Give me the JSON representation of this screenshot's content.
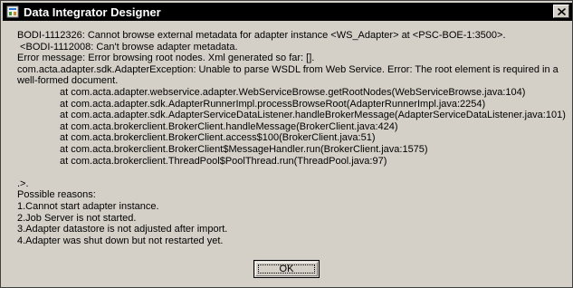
{
  "window": {
    "title": "Data Integrator Designer"
  },
  "message": {
    "line1": "BODI-1112326: Cannot browse external metadata for adapter instance <WS_Adapter> at <PSC-BOE-1:3500>.",
    "line2": " <BODI-1112008: Can't browse adapter metadata.",
    "line3": "Error message: Error browsing root nodes. Xml generated so far: [].",
    "line4": "com.acta.adapter.sdk.AdapterException: Unable to parse WSDL from Web Service. Error: The root element is required in a well-formed document.",
    "stack": [
      "at com.acta.adapter.webservice.adapter.WebServiceBrowse.getRootNodes(WebServiceBrowse.java:104)",
      "at com.acta.adapter.sdk.AdapterRunnerImpl.processBrowseRoot(AdapterRunnerImpl.java:2254)",
      "at com.acta.adapter.sdk.AdapterServiceDataListener.handleBrokerMessage(AdapterServiceDataListener.java:101)",
      "at com.acta.brokerclient.BrokerClient.handleMessage(BrokerClient.java:424)",
      "at com.acta.brokerclient.BrokerClient.access$100(BrokerClient.java:51)",
      "at com.acta.brokerclient.BrokerClient$MessageHandler.run(BrokerClient.java:1575)",
      "at com.acta.brokerclient.ThreadPool$PoolThread.run(ThreadPool.java:97)"
    ],
    "blank": "",
    "end_marker": ".>.",
    "reasons_header": "Possible reasons:",
    "reasons": [
      "1.Cannot start adapter instance.",
      "2.Job Server is not started.",
      "3.Adapter datastore is not adjusted after import.",
      "4.Adapter was shut down but not restarted yet."
    ]
  },
  "buttons": {
    "ok": "OK"
  },
  "icons": {
    "title": "app-icon",
    "close": "close-icon"
  }
}
